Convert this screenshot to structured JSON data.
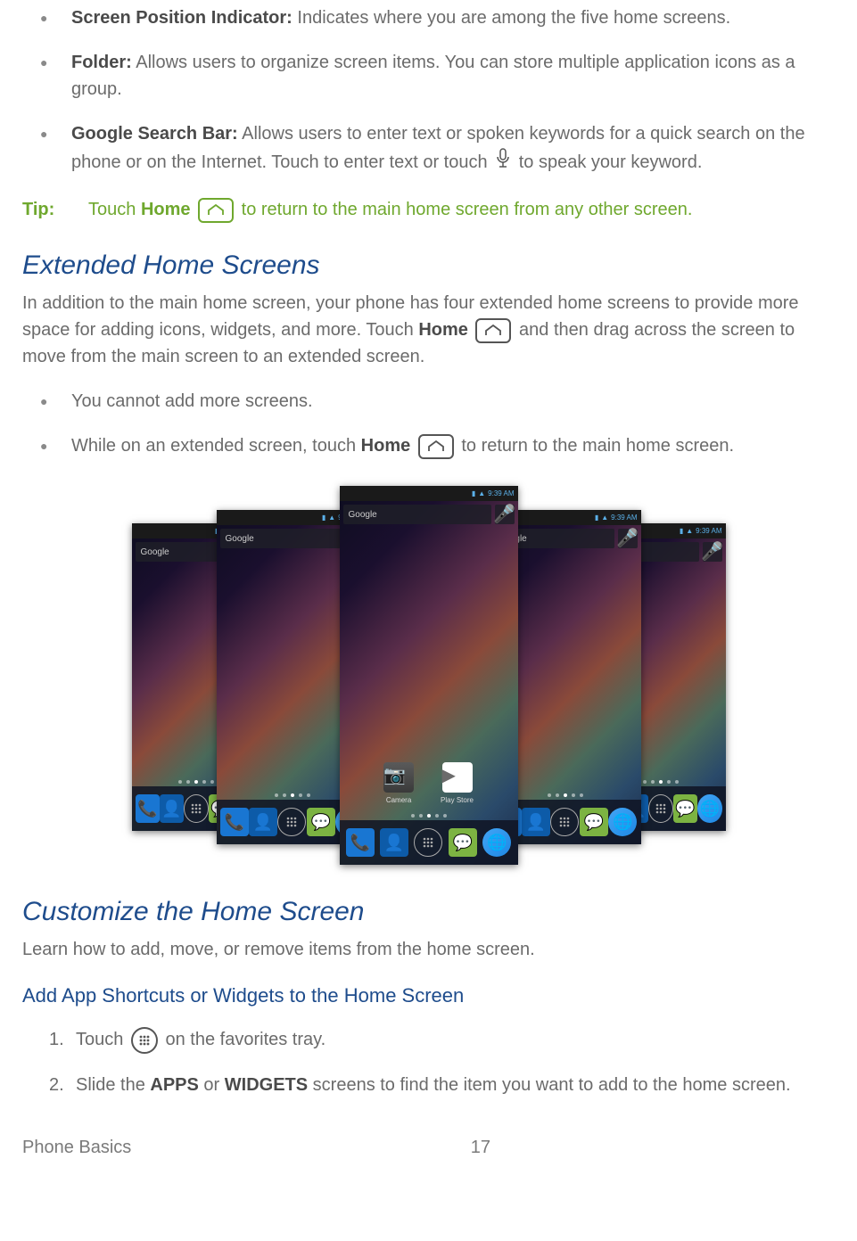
{
  "topBullets": [
    {
      "term": "Screen Position Indicator:",
      "text": " Indicates where you are among the five home screens."
    },
    {
      "term": "Folder:",
      "text": " Allows users to organize screen items. You can store multiple application icons as a group."
    },
    {
      "term": "Google Search Bar:",
      "text_before": " Allows users to enter text or spoken keywords for a quick search on the phone or on the Internet. Touch to enter text or touch ",
      "text_after": " to speak your keyword."
    }
  ],
  "tip": {
    "label": "Tip:",
    "before": "Touch ",
    "home": "Home",
    "after": " to return to the main home screen from any other screen."
  },
  "extended": {
    "heading": "Extended Home Screens",
    "body_before": "In addition to the main home screen, your phone has four extended home screens to provide more space for adding icons, widgets, and more. Touch ",
    "home": "Home",
    "body_after": " and then drag across the screen to move from the main screen to an extended screen.",
    "bullets": [
      {
        "text": "You cannot add more screens."
      },
      {
        "before": "While on an extended screen, touch ",
        "home": "Home",
        "after": " to return to the main home screen."
      }
    ]
  },
  "figure": {
    "time": "9:39 AM",
    "google": "Google",
    "camera": "Camera",
    "playstore": "Play Store"
  },
  "customize": {
    "heading": "Customize the Home Screen",
    "body": "Learn how to add, move, or remove items from the home screen.",
    "subheading": "Add App Shortcuts or Widgets to the Home Screen",
    "steps": [
      {
        "num": "1.",
        "before": "Touch ",
        "after": " on the favorites tray."
      },
      {
        "num": "2.",
        "before": "Slide the ",
        "apps": "APPS",
        "or": " or ",
        "widgets": "WIDGETS",
        "after": " screens to find the item you want to add to the home screen."
      }
    ]
  },
  "footer": {
    "section": "Phone Basics",
    "page": "17"
  }
}
